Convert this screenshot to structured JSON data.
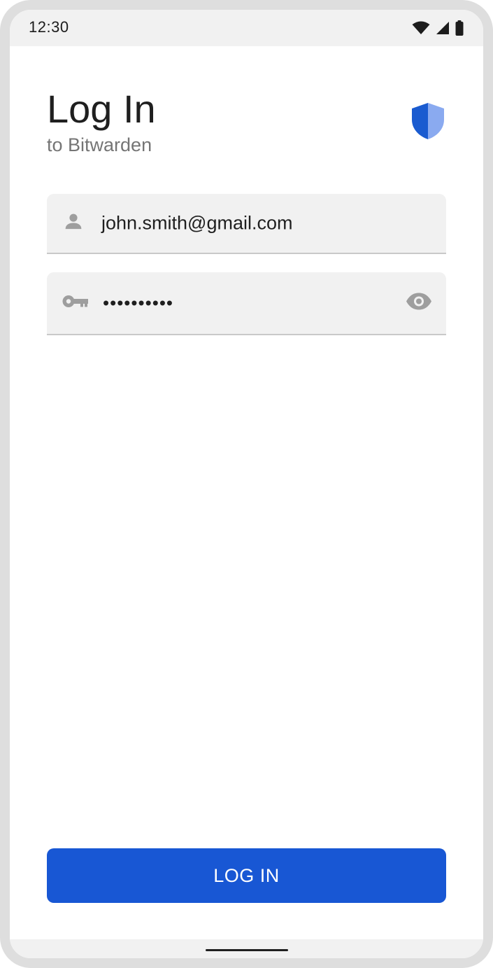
{
  "status_bar": {
    "time": "12:30",
    "icons": [
      "wifi-icon",
      "cellular-signal-icon",
      "battery-icon"
    ]
  },
  "header": {
    "title": "Log In",
    "subtitle": "to Bitwarden",
    "logo_icon": "shield-icon"
  },
  "form": {
    "email": {
      "icon": "person-icon",
      "value": "john.smith@gmail.com"
    },
    "password": {
      "icon": "key-icon",
      "value": "••••••••••",
      "toggle_icon": "eye-icon"
    }
  },
  "actions": {
    "login_label": "LOG IN"
  },
  "colors": {
    "accent": "#1857d4",
    "shield_dark": "#1a5bd0",
    "shield_light": "#8aaaf0",
    "field_bg": "#f1f1f1",
    "icon_gray": "#9e9e9e"
  }
}
